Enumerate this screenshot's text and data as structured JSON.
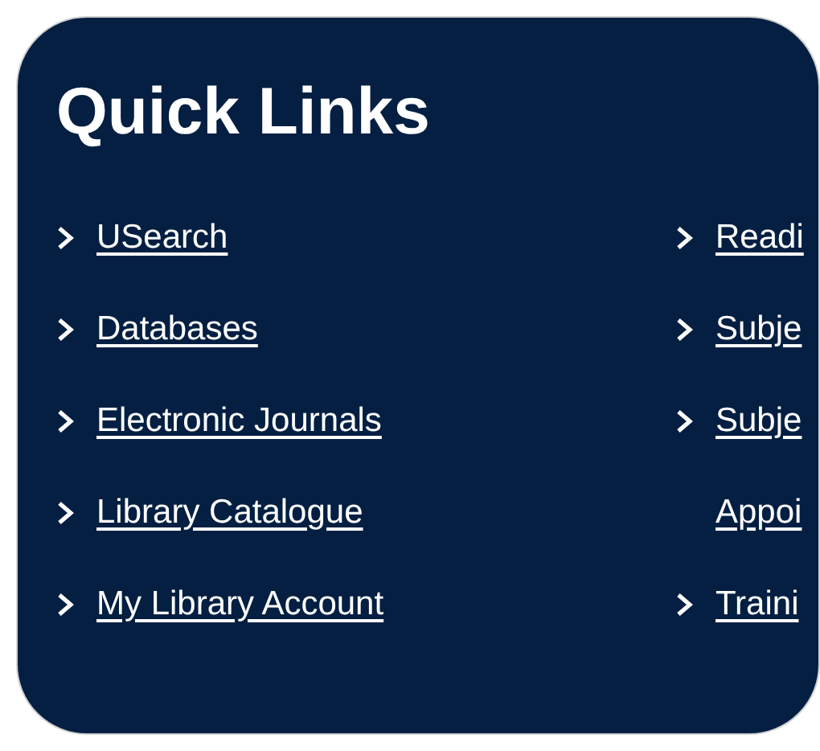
{
  "panel": {
    "title": "Quick Links",
    "columns": [
      {
        "links": [
          {
            "lines": [
              "USearch"
            ]
          },
          {
            "lines": [
              "Databases"
            ]
          },
          {
            "lines": [
              "Electronic Journals"
            ]
          },
          {
            "lines": [
              "Library Catalogue"
            ]
          },
          {
            "lines": [
              "My Library Account"
            ]
          }
        ]
      },
      {
        "links": [
          {
            "lines": [
              "Readi"
            ]
          },
          {
            "lines": [
              "Subje"
            ]
          },
          {
            "lines": [
              "Subje",
              "Appoi"
            ]
          },
          {
            "lines": [
              "Traini"
            ]
          }
        ]
      }
    ]
  }
}
